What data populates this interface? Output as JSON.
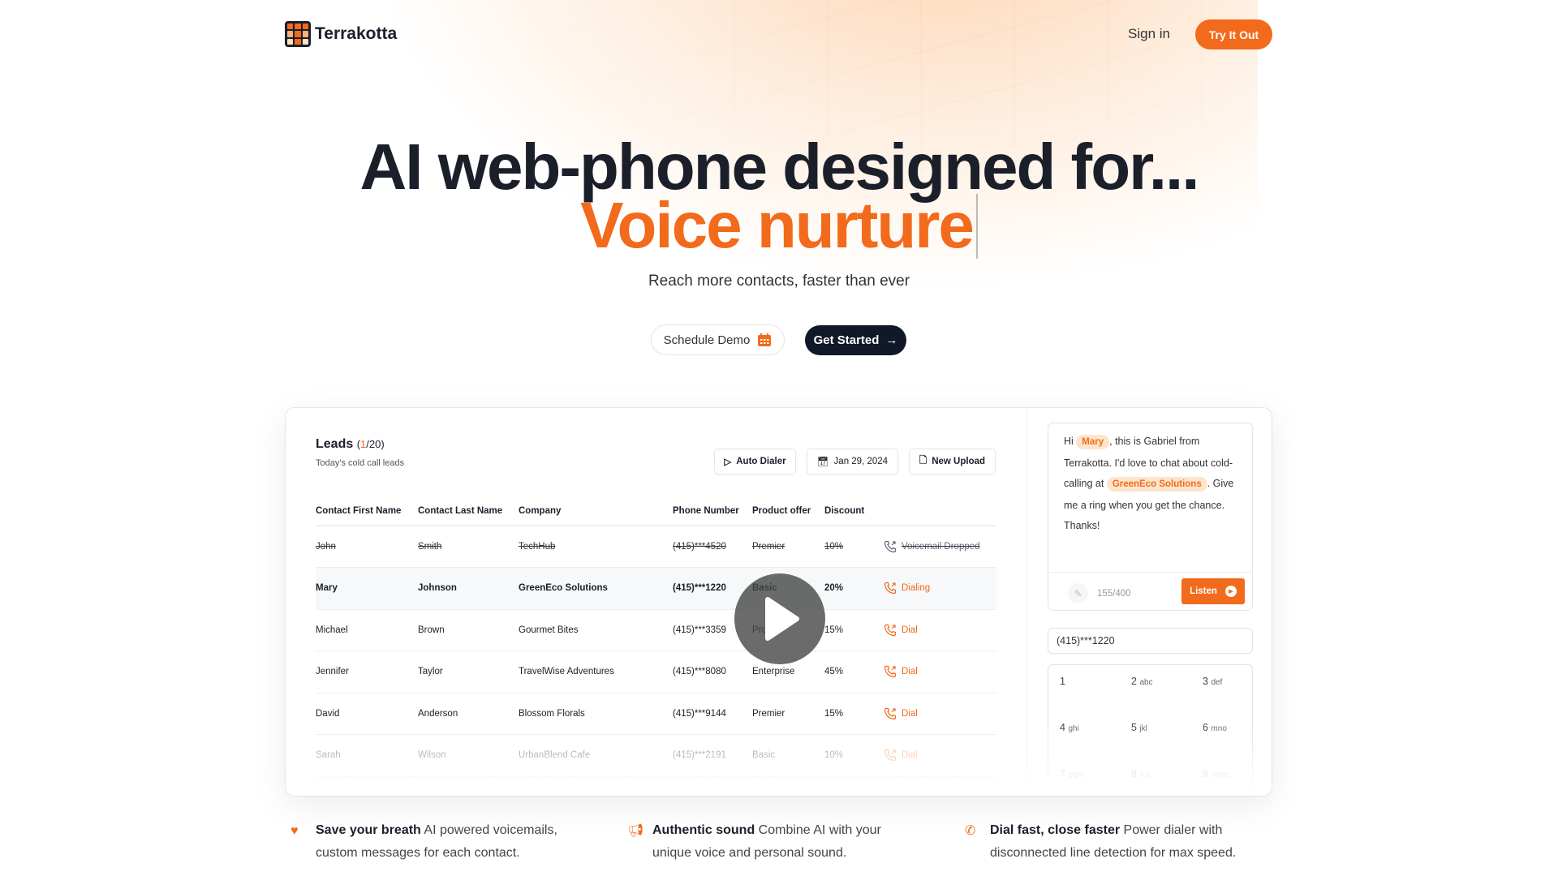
{
  "brand": {
    "name": "Terrakotta",
    "accent": "#f26a1b",
    "dark": "#111827"
  },
  "nav": {
    "sign_in": "Sign in",
    "try_it_out": "Try It Out"
  },
  "hero": {
    "headline": "AI web-phone designed for...",
    "rotating_word": "Voice nurture",
    "subtitle": "Reach more contacts, faster than ever",
    "schedule_demo": "Schedule Demo",
    "get_started": "Get Started"
  },
  "leads": {
    "title": "Leads",
    "count_current": "1",
    "count_total": "/20)",
    "count_open": "(",
    "subtitle": "Today's cold call leads",
    "toolbar": {
      "auto_dialer": "Auto Dialer",
      "date": "Jan 29, 2024",
      "new_upload": "New Upload"
    },
    "columns": [
      "Contact First Name",
      "Contact Last Name",
      "Company",
      "Phone Number",
      "Product offer",
      "Discount"
    ],
    "rows": [
      {
        "first": "John",
        "last": "Smith",
        "company": "TechHub",
        "phone": "(415)***4520",
        "product": "Premier",
        "discount": "10%",
        "status": "Voicemail Dropped",
        "state": "done"
      },
      {
        "first": "Mary",
        "last": "Johnson",
        "company": "GreenEco Solutions",
        "phone": "(415)***1220",
        "product": "Basic",
        "discount": "20%",
        "status": "Dialing",
        "state": "active"
      },
      {
        "first": "Michael",
        "last": "Brown",
        "company": "Gourmet Bites",
        "phone": "(415)***3359",
        "product": "Pro",
        "discount": "15%",
        "status": "Dial",
        "state": ""
      },
      {
        "first": "Jennifer",
        "last": "Taylor",
        "company": "TravelWise Adventures",
        "phone": "(415)***8080",
        "product": "Enterprise",
        "discount": "45%",
        "status": "Dial",
        "state": ""
      },
      {
        "first": "David",
        "last": "Anderson",
        "company": "Blossom Florals",
        "phone": "(415)***9144",
        "product": "Premier",
        "discount": "15%",
        "status": "Dial",
        "state": ""
      },
      {
        "first": "Sarah",
        "last": "Wilson",
        "company": "UrbanBlend Cafe",
        "phone": "(415)***2191",
        "product": "Basic",
        "discount": "10%",
        "status": "Dial",
        "state": "dim"
      }
    ]
  },
  "message": {
    "p1": "Hi ",
    "name": "Mary",
    "p2": ", this is Gabriel from Terrakotta. I'd love to chat about cold-calling at ",
    "company": "GreenEco Solutions",
    "p3": ". Give me a ring when you get the chance. Thanks!",
    "char_count": "155/400",
    "listen": "Listen"
  },
  "dialer": {
    "number": "(415)***1220",
    "keys": [
      [
        "1",
        ""
      ],
      [
        "2",
        "abc"
      ],
      [
        "3",
        "def"
      ],
      [
        "4",
        "ghi"
      ],
      [
        "5",
        "jkl"
      ],
      [
        "6",
        "mno"
      ],
      [
        "7",
        "pqrs"
      ],
      [
        "8",
        "tuv"
      ],
      [
        "9",
        "wxyz"
      ]
    ]
  },
  "features": [
    {
      "icon": "heart-icon",
      "title": "Save your breath",
      "text": " AI powered voicemails, custom messages for each contact."
    },
    {
      "icon": "megaphone-icon",
      "title": "Authentic sound",
      "text": " Combine AI with your unique voice and personal sound."
    },
    {
      "icon": "phone-icon",
      "title": "Dial fast, close faster",
      "text": " Power dialer with disconnected line detection for max speed."
    }
  ]
}
